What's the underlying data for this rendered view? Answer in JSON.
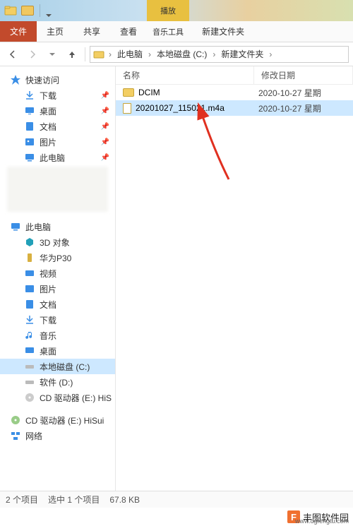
{
  "titlebar": {
    "play_context": "播放",
    "window_title": "新建文件夹"
  },
  "ribbon": {
    "file": "文件",
    "home": "主页",
    "share": "共享",
    "view": "查看",
    "music_tools": "音乐工具"
  },
  "nav": {
    "crumbs": [
      "此电脑",
      "本地磁盘 (C:)",
      "新建文件夹"
    ]
  },
  "columns": {
    "name": "名称",
    "date": "修改日期"
  },
  "files": [
    {
      "name": "DCIM",
      "type": "folder",
      "date": "2020-10-27 星期",
      "selected": false
    },
    {
      "name": "20201027_115021.m4a",
      "type": "file",
      "date": "2020-10-27 星期",
      "selected": true
    }
  ],
  "sidebar": {
    "quick": {
      "label": "快速访问",
      "items": [
        {
          "label": "下载",
          "icon": "dl",
          "pinned": true
        },
        {
          "label": "桌面",
          "icon": "desktop",
          "pinned": true
        },
        {
          "label": "文档",
          "icon": "doc",
          "pinned": true
        },
        {
          "label": "图片",
          "icon": "pic",
          "pinned": true
        },
        {
          "label": "此电脑",
          "icon": "pc",
          "pinned": true
        }
      ]
    },
    "thispc": {
      "label": "此电脑",
      "items": [
        {
          "label": "3D 对象",
          "icon": "3d"
        },
        {
          "label": "华为P30",
          "icon": "phone"
        },
        {
          "label": "视频",
          "icon": "video"
        },
        {
          "label": "图片",
          "icon": "pic"
        },
        {
          "label": "文档",
          "icon": "doc"
        },
        {
          "label": "下载",
          "icon": "dl"
        },
        {
          "label": "音乐",
          "icon": "music"
        },
        {
          "label": "桌面",
          "icon": "desktop"
        },
        {
          "label": "本地磁盘 (C:)",
          "icon": "drive",
          "selected": true
        },
        {
          "label": "软件 (D:)",
          "icon": "drive"
        },
        {
          "label": "CD 驱动器 (E:) HiS",
          "icon": "cd"
        }
      ]
    },
    "extra": [
      {
        "label": "CD 驱动器 (E:) HiSui",
        "icon": "cd"
      },
      {
        "label": "网络",
        "icon": "net"
      }
    ]
  },
  "status": {
    "count": "2 个项目",
    "selection": "选中 1 个项目",
    "size": "67.8 KB"
  },
  "watermark": {
    "name": "丰图软件园",
    "url": "www.dgfengtu.com"
  }
}
